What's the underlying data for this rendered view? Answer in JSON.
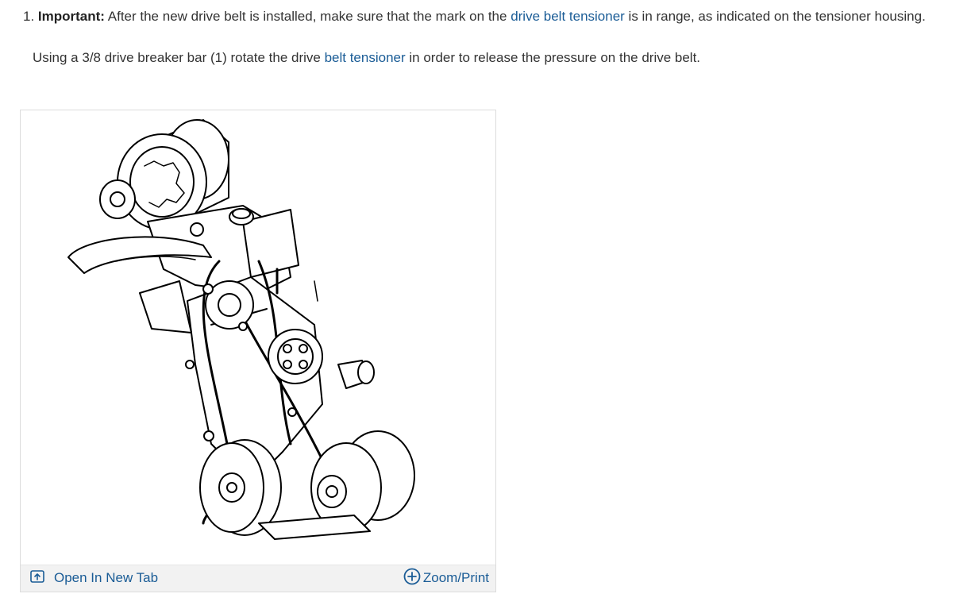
{
  "step": {
    "number": "1.",
    "important_label": "Important:",
    "text_before_link": " After the new drive belt is installed, make sure that the mark on the ",
    "link_text": "drive belt tensioner",
    "text_after_link": " is in range, as indicated on the tensioner housing."
  },
  "substep": {
    "text_before_link": "Using a 3/8 drive breaker bar (1) rotate the drive ",
    "link_text": "belt tensioner",
    "text_after_link": " in order to release the pressure on the drive belt."
  },
  "figure": {
    "open_tab_label": "Open In New Tab",
    "open_tab_icon": "open-new-tab-icon",
    "zoom_label": "Zoom/Print",
    "zoom_icon": "plus-circle-icon",
    "accent_color": "#1a5c96"
  }
}
